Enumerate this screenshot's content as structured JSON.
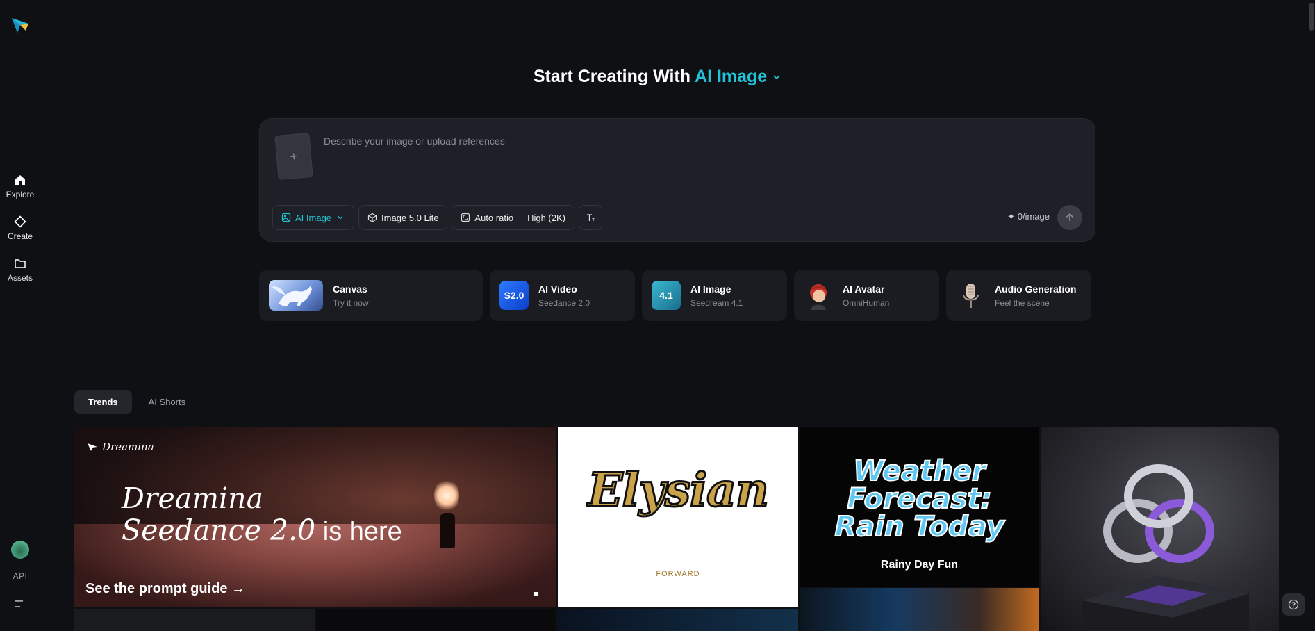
{
  "sidebar": {
    "nav": [
      {
        "label": "Explore",
        "icon": "home-icon"
      },
      {
        "label": "Create",
        "icon": "diamond-icon"
      },
      {
        "label": "Assets",
        "icon": "folder-icon"
      }
    ],
    "api_label": "API"
  },
  "heading": {
    "prefix": "Start Creating With",
    "mode": "AI Image"
  },
  "prompt": {
    "placeholder": "Describe your image or upload references",
    "upload_symbol": "+",
    "mode_pill": "AI Image",
    "model_pill": "Image 5.0 Lite",
    "ratio_pill": "Auto ratio",
    "quality_pill": "High (2K)",
    "credits": "✦ 0/image"
  },
  "features": [
    {
      "title": "Canvas",
      "subtitle": "Try it now"
    },
    {
      "title": "AI Video",
      "subtitle": "Seedance 2.0",
      "badge": "S2.0"
    },
    {
      "title": "AI Image",
      "subtitle": "Seedream 4.1",
      "badge": "4.1"
    },
    {
      "title": "AI Avatar",
      "subtitle": "OmniHuman"
    },
    {
      "title": "Audio Generation",
      "subtitle": "Feel the scene"
    }
  ],
  "tabs": [
    {
      "label": "Trends",
      "active": true
    },
    {
      "label": "AI Shorts",
      "active": false
    }
  ],
  "gallery": {
    "hero": {
      "brand": "Dreamina",
      "headline_line1": "Dreamina",
      "headline_line2": "Seedance 2.0",
      "headline_suffix": " is here",
      "cta": "See the prompt guide →"
    },
    "elysian": {
      "word": "Elysian",
      "sub": "FORWARD"
    },
    "weather": {
      "title_l1": "Weather",
      "title_l2": "Forecast:",
      "title_l3": "Rain Today",
      "caption": "Rainy Day Fun"
    }
  },
  "colors": {
    "accent": "#22c3d6",
    "background": "#0f1014",
    "panel": "#1e2027"
  }
}
